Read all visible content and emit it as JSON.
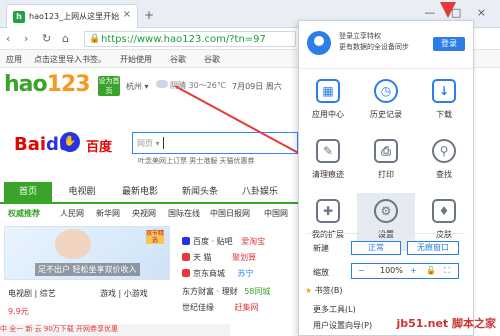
{
  "browser": {
    "tab_title": "hao123_上网从这里开始",
    "tab_close": "×",
    "new_tab": "+",
    "window_controls": "— □ ×",
    "url": "https://www.hao123.com/?tn=97",
    "favicon": "h"
  },
  "nav": {
    "back": "‹",
    "forward": "›",
    "reload": "↻",
    "home": "⌂"
  },
  "bookmarks": [
    "应用",
    "点击这里导入书签。",
    "开始使用",
    "谷歌",
    "谷歌"
  ],
  "header": {
    "logo_prefix": "hao",
    "logo_num": "123",
    "logo_suffix": ".com",
    "home_badge": "设为首页",
    "city": "杭州 ▾",
    "weather": "阴晴  30～26℃",
    "date": "7月09日 周六"
  },
  "search": {
    "engine": "百度",
    "type_label": "网页 ▾",
    "hot_words": "叶念美网上订票   男士港服  天猫优惠券"
  },
  "categories": [
    "首页",
    "电视剧",
    "最新电影",
    "新闻头条",
    "八卦娱乐"
  ],
  "sites_row": [
    "权威推荐",
    "人民网",
    "新华网",
    "央视网",
    "国际在线",
    "中国日报网",
    "中国网"
  ],
  "banner": {
    "text": "足不出户 轻松坐享双价收入",
    "tag": "双节精选"
  },
  "site_list": [
    {
      "label": "百度 · 贴吧",
      "extra": "爱淘宝"
    },
    {
      "label": "天  猫",
      "extra": "聚划算"
    },
    {
      "label": "京东商城",
      "extra": "苏宁"
    },
    {
      "label": "东方财富 · 理财",
      "extra": "58同城"
    },
    {
      "label": "世纪佳缘",
      "extra": "赶集网"
    }
  ],
  "bottom_links": [
    {
      "a": "电视剧 | 综艺",
      "b": "游戏 | 小游戏"
    },
    {
      "a": "9.9元",
      "b": ""
    }
  ],
  "bottom_bar": "中 全一 新 云 90万下载 开网券享优惠",
  "menu": {
    "login_line1": "登录立享特权",
    "login_line2": "更有数据的全设备同步",
    "login_button": "登录",
    "items": [
      {
        "label": "应用中心",
        "icon": "app-center-icon",
        "glyph": "▦"
      },
      {
        "label": "历史记录",
        "icon": "history-icon",
        "glyph": "◷"
      },
      {
        "label": "下载",
        "icon": "download-icon",
        "glyph": "↓"
      },
      {
        "label": "清理痕迹",
        "icon": "clean-icon",
        "glyph": "✎"
      },
      {
        "label": "打印",
        "icon": "print-icon",
        "glyph": "⎙"
      },
      {
        "label": "查找",
        "icon": "find-icon",
        "glyph": "⚲"
      },
      {
        "label": "我的扩展",
        "icon": "extension-icon",
        "glyph": "✚"
      },
      {
        "label": "设置",
        "icon": "settings-icon",
        "glyph": "⚙"
      },
      {
        "label": "皮肤",
        "icon": "skin-icon",
        "glyph": "♦"
      }
    ],
    "new_label": "新建",
    "normal_mode": "正常",
    "incognito_mode": "无痕窗口",
    "zoom_label": "缩放",
    "zoom_minus": "−",
    "zoom_value": "100%",
    "zoom_plus": "+",
    "bookmarks": "书签(B)",
    "more_tools": "更多工具(L)",
    "user_guide": "用户设置向导(P)"
  },
  "watermark": "jb51.net  脚本之家",
  "colors": {
    "accent": "#2b7de9",
    "hao_green": "#3aa32a",
    "arrow_red": "#e53935"
  }
}
